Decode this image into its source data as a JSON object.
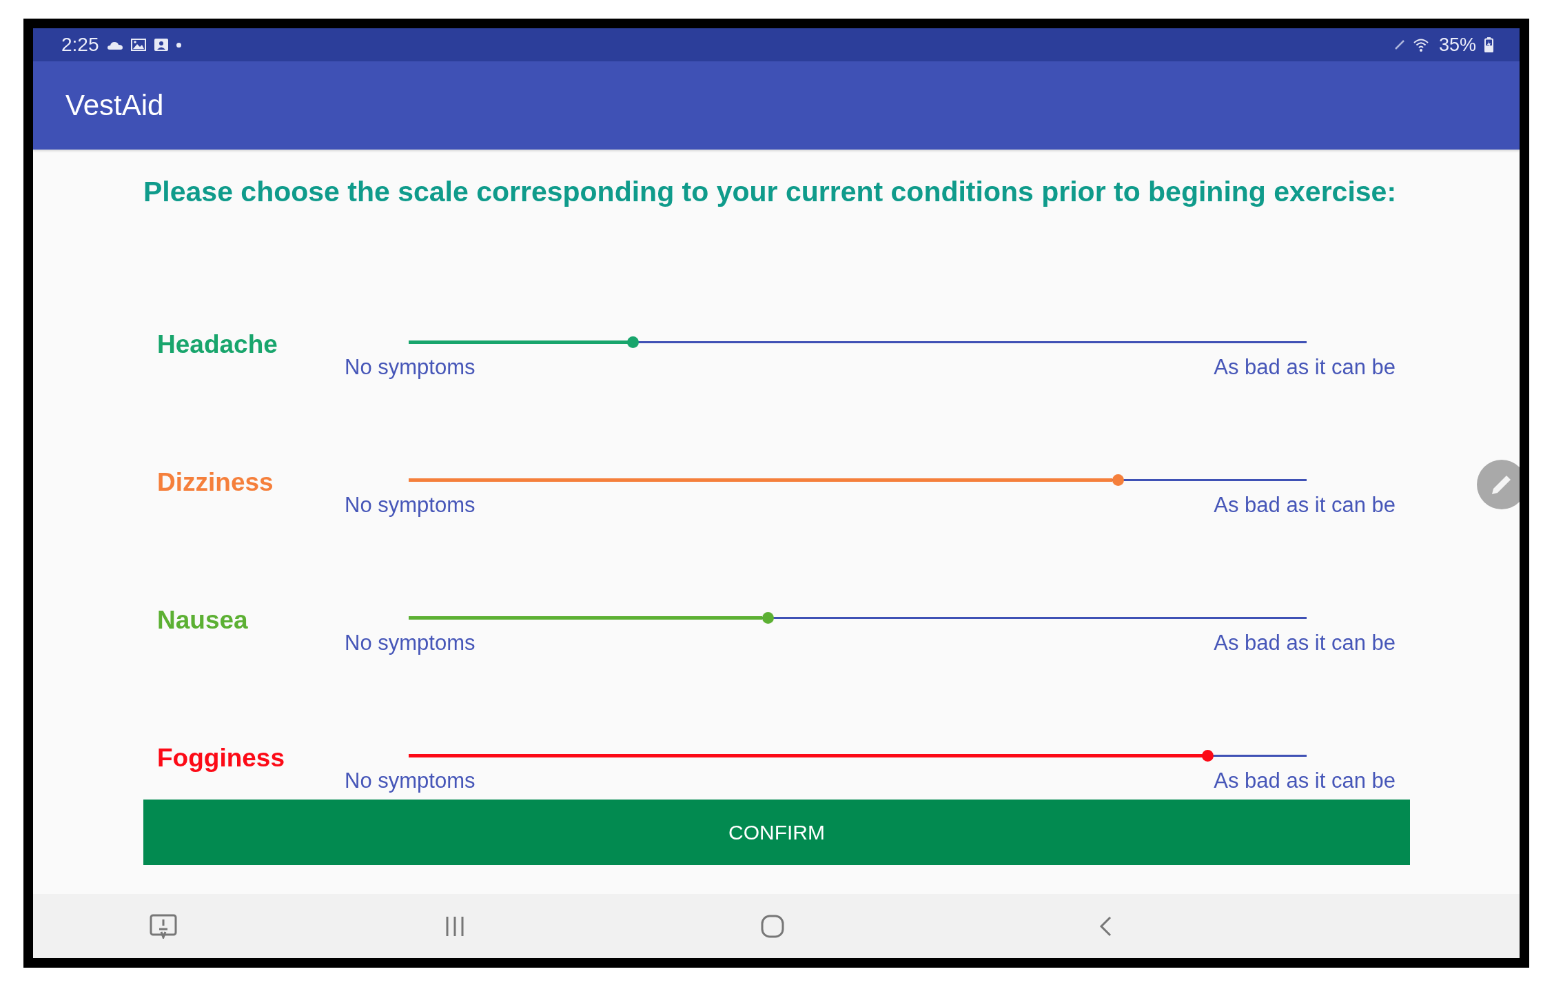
{
  "status_bar": {
    "time": "2:25",
    "battery": "35%"
  },
  "app_bar": {
    "title": "VestAid"
  },
  "prompt": "Please choose the scale corresponding to your current conditions prior to begining exercise:",
  "symptoms": [
    {
      "name": "Headache",
      "color": "#18a56c",
      "level": 0.25,
      "min_label": "No symptoms",
      "max_label": "As bad as it can be"
    },
    {
      "name": "Dizziness",
      "color": "#f57f3b",
      "level": 0.79,
      "min_label": "No symptoms",
      "max_label": "As bad as it can be"
    },
    {
      "name": "Nausea",
      "color": "#5cb033",
      "level": 0.4,
      "min_label": "No symptoms",
      "max_label": "As bad as it can be"
    },
    {
      "name": "Fogginess",
      "color": "#fc0a16",
      "level": 0.89,
      "min_label": "No symptoms",
      "max_label": "As bad as it can be"
    }
  ],
  "confirm_button": {
    "label": "CONFIRM"
  }
}
